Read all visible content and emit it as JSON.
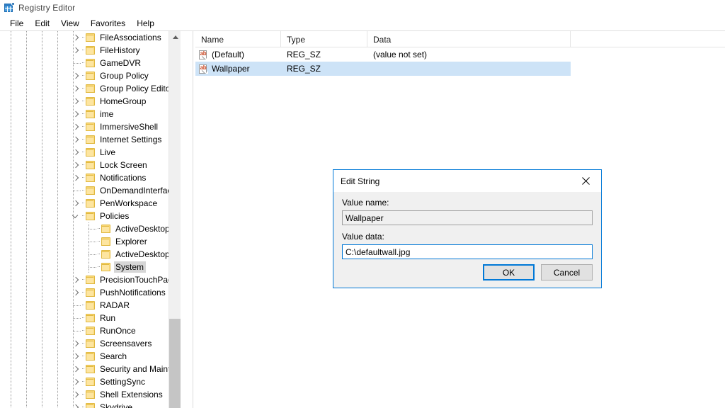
{
  "window": {
    "title": "Registry Editor",
    "icon": "registry-grid-icon"
  },
  "menubar": {
    "items": [
      {
        "label": "File"
      },
      {
        "label": "Edit"
      },
      {
        "label": "View"
      },
      {
        "label": "Favorites"
      },
      {
        "label": "Help"
      }
    ]
  },
  "tree": {
    "nodes": [
      {
        "label": "FileAssociations",
        "indent": 0,
        "state": "collapsed",
        "selected": false
      },
      {
        "label": "FileHistory",
        "indent": 0,
        "state": "collapsed",
        "selected": false
      },
      {
        "label": "GameDVR",
        "indent": 0,
        "state": "leaf",
        "selected": false
      },
      {
        "label": "Group Policy",
        "indent": 0,
        "state": "collapsed",
        "selected": false
      },
      {
        "label": "Group Policy Editor",
        "indent": 0,
        "state": "collapsed",
        "selected": false
      },
      {
        "label": "HomeGroup",
        "indent": 0,
        "state": "collapsed",
        "selected": false
      },
      {
        "label": "ime",
        "indent": 0,
        "state": "collapsed",
        "selected": false
      },
      {
        "label": "ImmersiveShell",
        "indent": 0,
        "state": "collapsed",
        "selected": false
      },
      {
        "label": "Internet Settings",
        "indent": 0,
        "state": "collapsed",
        "selected": false
      },
      {
        "label": "Live",
        "indent": 0,
        "state": "collapsed",
        "selected": false
      },
      {
        "label": "Lock Screen",
        "indent": 0,
        "state": "collapsed",
        "selected": false
      },
      {
        "label": "Notifications",
        "indent": 0,
        "state": "collapsed",
        "selected": false
      },
      {
        "label": "OnDemandInterfaceCa",
        "indent": 0,
        "state": "leaf",
        "selected": false
      },
      {
        "label": "PenWorkspace",
        "indent": 0,
        "state": "collapsed",
        "selected": false
      },
      {
        "label": "Policies",
        "indent": 0,
        "state": "expanded",
        "selected": false
      },
      {
        "label": "ActiveDesktop",
        "indent": 1,
        "state": "leaf",
        "selected": false
      },
      {
        "label": "Explorer",
        "indent": 1,
        "state": "leaf",
        "selected": false
      },
      {
        "label": "ActiveDesktop",
        "indent": 1,
        "state": "leaf",
        "selected": false
      },
      {
        "label": "System",
        "indent": 1,
        "state": "leaf",
        "selected": true
      },
      {
        "label": "PrecisionTouchPad",
        "indent": 0,
        "state": "collapsed",
        "selected": false
      },
      {
        "label": "PushNotifications",
        "indent": 0,
        "state": "collapsed",
        "selected": false
      },
      {
        "label": "RADAR",
        "indent": 0,
        "state": "leaf",
        "selected": false
      },
      {
        "label": "Run",
        "indent": 0,
        "state": "leaf",
        "selected": false
      },
      {
        "label": "RunOnce",
        "indent": 0,
        "state": "leaf",
        "selected": false
      },
      {
        "label": "Screensavers",
        "indent": 0,
        "state": "collapsed",
        "selected": false
      },
      {
        "label": "Search",
        "indent": 0,
        "state": "collapsed",
        "selected": false
      },
      {
        "label": "Security and Maintena",
        "indent": 0,
        "state": "collapsed",
        "selected": false
      },
      {
        "label": "SettingSync",
        "indent": 0,
        "state": "collapsed",
        "selected": false
      },
      {
        "label": "Shell Extensions",
        "indent": 0,
        "state": "collapsed",
        "selected": false
      },
      {
        "label": "Skydrive",
        "indent": 0,
        "state": "collapsed",
        "selected": false
      }
    ],
    "scrollbar": {
      "up_arrow": "chevron-up-icon",
      "down_arrow": "chevron-down-icon"
    }
  },
  "values_list": {
    "columns": [
      {
        "label": "Name"
      },
      {
        "label": "Type"
      },
      {
        "label": "Data"
      }
    ],
    "rows": [
      {
        "icon": "string-value-icon",
        "name": "(Default)",
        "type": "REG_SZ",
        "data": "(value not set)",
        "selected": false
      },
      {
        "icon": "string-value-icon",
        "name": "Wallpaper",
        "type": "REG_SZ",
        "data": "",
        "selected": true
      }
    ]
  },
  "dialog": {
    "title": "Edit String",
    "close_icon": "close-icon",
    "value_name_label": "Value name:",
    "value_name": "Wallpaper",
    "value_data_label": "Value data:",
    "value_data": "C:\\defaultwall.jpg",
    "ok_label": "OK",
    "cancel_label": "Cancel"
  },
  "colors": {
    "accent": "#0078d7",
    "selection": "#cde3f7",
    "tree_selection": "#d6d6d6",
    "folder": "#fbd97a",
    "dialog_bg": "#f0f0f0"
  }
}
